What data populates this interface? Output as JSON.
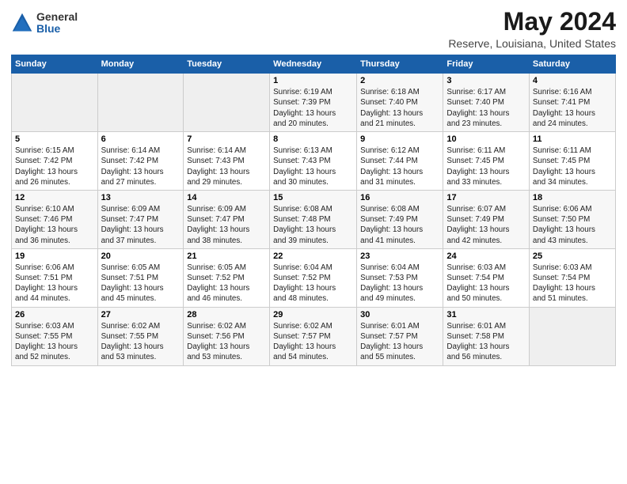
{
  "logo": {
    "general": "General",
    "blue": "Blue"
  },
  "title": "May 2024",
  "subtitle": "Reserve, Louisiana, United States",
  "days_header": [
    "Sunday",
    "Monday",
    "Tuesday",
    "Wednesday",
    "Thursday",
    "Friday",
    "Saturday"
  ],
  "weeks": [
    [
      {
        "day": "",
        "info": ""
      },
      {
        "day": "",
        "info": ""
      },
      {
        "day": "",
        "info": ""
      },
      {
        "day": "1",
        "info": "Sunrise: 6:19 AM\nSunset: 7:39 PM\nDaylight: 13 hours\nand 20 minutes."
      },
      {
        "day": "2",
        "info": "Sunrise: 6:18 AM\nSunset: 7:40 PM\nDaylight: 13 hours\nand 21 minutes."
      },
      {
        "day": "3",
        "info": "Sunrise: 6:17 AM\nSunset: 7:40 PM\nDaylight: 13 hours\nand 23 minutes."
      },
      {
        "day": "4",
        "info": "Sunrise: 6:16 AM\nSunset: 7:41 PM\nDaylight: 13 hours\nand 24 minutes."
      }
    ],
    [
      {
        "day": "5",
        "info": "Sunrise: 6:15 AM\nSunset: 7:42 PM\nDaylight: 13 hours\nand 26 minutes."
      },
      {
        "day": "6",
        "info": "Sunrise: 6:14 AM\nSunset: 7:42 PM\nDaylight: 13 hours\nand 27 minutes."
      },
      {
        "day": "7",
        "info": "Sunrise: 6:14 AM\nSunset: 7:43 PM\nDaylight: 13 hours\nand 29 minutes."
      },
      {
        "day": "8",
        "info": "Sunrise: 6:13 AM\nSunset: 7:43 PM\nDaylight: 13 hours\nand 30 minutes."
      },
      {
        "day": "9",
        "info": "Sunrise: 6:12 AM\nSunset: 7:44 PM\nDaylight: 13 hours\nand 31 minutes."
      },
      {
        "day": "10",
        "info": "Sunrise: 6:11 AM\nSunset: 7:45 PM\nDaylight: 13 hours\nand 33 minutes."
      },
      {
        "day": "11",
        "info": "Sunrise: 6:11 AM\nSunset: 7:45 PM\nDaylight: 13 hours\nand 34 minutes."
      }
    ],
    [
      {
        "day": "12",
        "info": "Sunrise: 6:10 AM\nSunset: 7:46 PM\nDaylight: 13 hours\nand 36 minutes."
      },
      {
        "day": "13",
        "info": "Sunrise: 6:09 AM\nSunset: 7:47 PM\nDaylight: 13 hours\nand 37 minutes."
      },
      {
        "day": "14",
        "info": "Sunrise: 6:09 AM\nSunset: 7:47 PM\nDaylight: 13 hours\nand 38 minutes."
      },
      {
        "day": "15",
        "info": "Sunrise: 6:08 AM\nSunset: 7:48 PM\nDaylight: 13 hours\nand 39 minutes."
      },
      {
        "day": "16",
        "info": "Sunrise: 6:08 AM\nSunset: 7:49 PM\nDaylight: 13 hours\nand 41 minutes."
      },
      {
        "day": "17",
        "info": "Sunrise: 6:07 AM\nSunset: 7:49 PM\nDaylight: 13 hours\nand 42 minutes."
      },
      {
        "day": "18",
        "info": "Sunrise: 6:06 AM\nSunset: 7:50 PM\nDaylight: 13 hours\nand 43 minutes."
      }
    ],
    [
      {
        "day": "19",
        "info": "Sunrise: 6:06 AM\nSunset: 7:51 PM\nDaylight: 13 hours\nand 44 minutes."
      },
      {
        "day": "20",
        "info": "Sunrise: 6:05 AM\nSunset: 7:51 PM\nDaylight: 13 hours\nand 45 minutes."
      },
      {
        "day": "21",
        "info": "Sunrise: 6:05 AM\nSunset: 7:52 PM\nDaylight: 13 hours\nand 46 minutes."
      },
      {
        "day": "22",
        "info": "Sunrise: 6:04 AM\nSunset: 7:52 PM\nDaylight: 13 hours\nand 48 minutes."
      },
      {
        "day": "23",
        "info": "Sunrise: 6:04 AM\nSunset: 7:53 PM\nDaylight: 13 hours\nand 49 minutes."
      },
      {
        "day": "24",
        "info": "Sunrise: 6:03 AM\nSunset: 7:54 PM\nDaylight: 13 hours\nand 50 minutes."
      },
      {
        "day": "25",
        "info": "Sunrise: 6:03 AM\nSunset: 7:54 PM\nDaylight: 13 hours\nand 51 minutes."
      }
    ],
    [
      {
        "day": "26",
        "info": "Sunrise: 6:03 AM\nSunset: 7:55 PM\nDaylight: 13 hours\nand 52 minutes."
      },
      {
        "day": "27",
        "info": "Sunrise: 6:02 AM\nSunset: 7:55 PM\nDaylight: 13 hours\nand 53 minutes."
      },
      {
        "day": "28",
        "info": "Sunrise: 6:02 AM\nSunset: 7:56 PM\nDaylight: 13 hours\nand 53 minutes."
      },
      {
        "day": "29",
        "info": "Sunrise: 6:02 AM\nSunset: 7:57 PM\nDaylight: 13 hours\nand 54 minutes."
      },
      {
        "day": "30",
        "info": "Sunrise: 6:01 AM\nSunset: 7:57 PM\nDaylight: 13 hours\nand 55 minutes."
      },
      {
        "day": "31",
        "info": "Sunrise: 6:01 AM\nSunset: 7:58 PM\nDaylight: 13 hours\nand 56 minutes."
      },
      {
        "day": "",
        "info": ""
      }
    ]
  ]
}
